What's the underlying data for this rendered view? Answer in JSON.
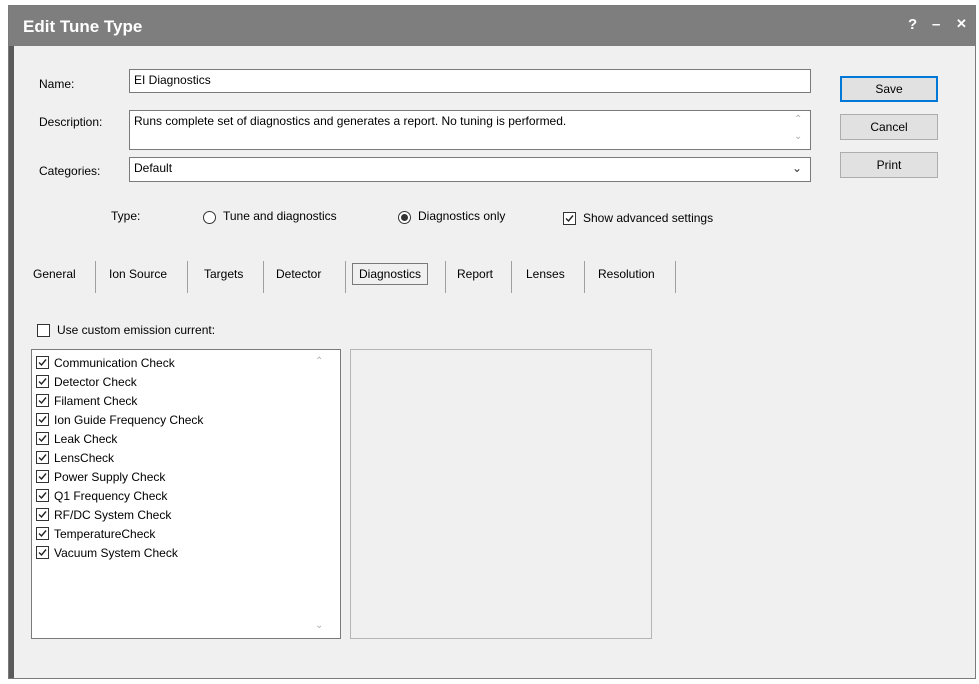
{
  "window": {
    "title": "Edit Tune Type",
    "help": "?",
    "minimize": "–",
    "close": "✕"
  },
  "form": {
    "name_label": "Name:",
    "name_value": "EI Diagnostics",
    "description_label": "Description:",
    "description_value": "Runs complete set of diagnostics and generates a report. No tuning is performed.",
    "categories_label": "Categories:",
    "categories_value": "Default",
    "type_label": "Type:",
    "radio_tune": "Tune and diagnostics",
    "radio_diag": "Diagnostics only",
    "show_advanced": "Show advanced settings"
  },
  "buttons": {
    "save": "Save",
    "cancel": "Cancel",
    "print": "Print"
  },
  "tabs": [
    "General",
    "Ion Source",
    "Targets",
    "Detector",
    "Diagnostics",
    "Report",
    "Lenses",
    "Resolution"
  ],
  "active_tab": "Diagnostics",
  "diagnostics": {
    "custom_emission_label": "Use custom emission current:",
    "checks": [
      "Communication Check",
      "Detector Check",
      "Filament Check",
      "Ion Guide Frequency Check",
      "Leak Check",
      "LensCheck",
      "Power Supply Check",
      "Q1 Frequency Check",
      "RF/DC System Check",
      "TemperatureCheck",
      "Vacuum System Check"
    ]
  }
}
